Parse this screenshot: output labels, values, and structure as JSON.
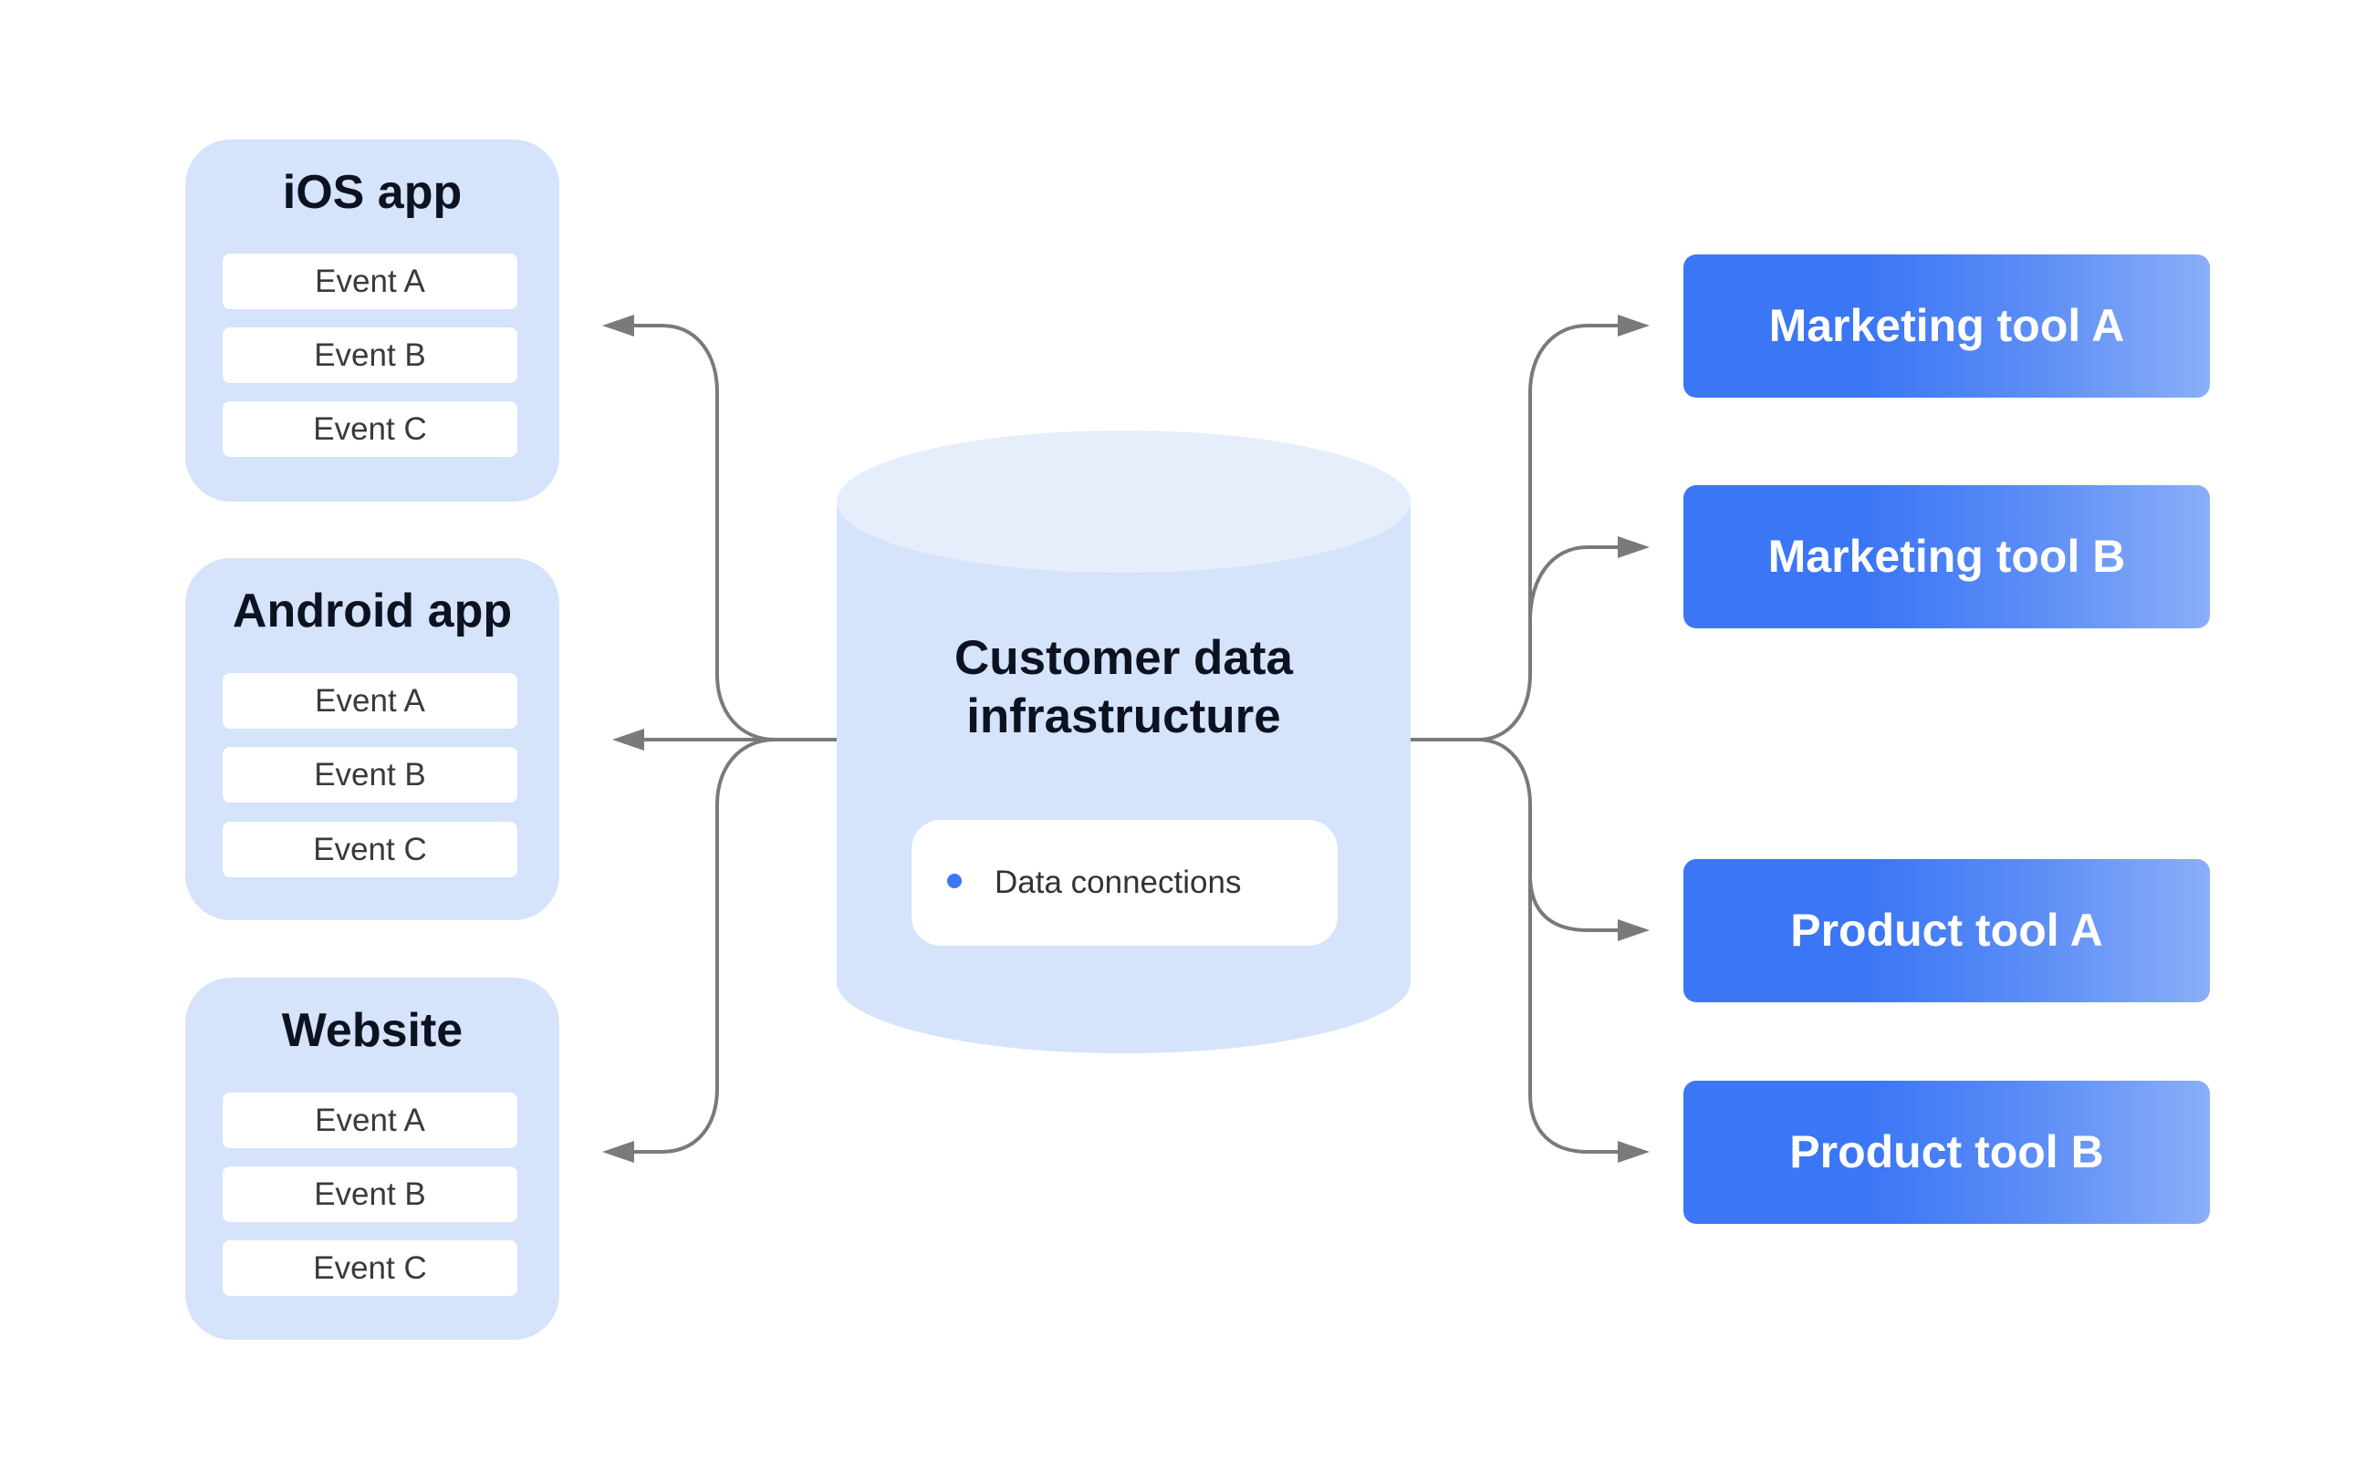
{
  "sources": [
    {
      "title": "iOS app",
      "events": [
        "Event A",
        "Event B",
        "Event C"
      ]
    },
    {
      "title": "Android app",
      "events": [
        "Event A",
        "Event B",
        "Event C"
      ]
    },
    {
      "title": "Website",
      "events": [
        "Event A",
        "Event B",
        "Event C"
      ]
    }
  ],
  "hub": {
    "title_line1": "Customer data",
    "title_line2": "infrastructure",
    "connections_label": "Data connections",
    "connections_icon": "bullet-dot-icon"
  },
  "destinations": [
    {
      "label": "Marketing tool A"
    },
    {
      "label": "Marketing tool B"
    },
    {
      "label": "Product tool A"
    },
    {
      "label": "Product tool B"
    }
  ],
  "colors": {
    "source_bg": "#d5e3fb",
    "cylinder_body": "#d5e3fb",
    "cylinder_top": "#e6eefc",
    "tool_blue": "#3b76f5",
    "tool_blue_light": "#8aaef8",
    "connector": "#7a7a7a",
    "dot": "#3b76f5"
  }
}
